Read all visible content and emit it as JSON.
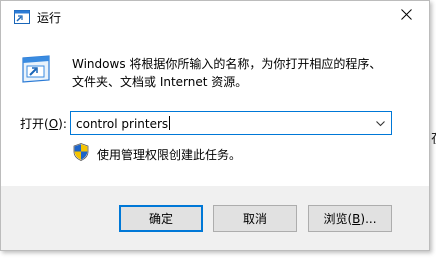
{
  "window": {
    "title": "运行",
    "close_label": "✕"
  },
  "description": {
    "line1": "Windows 将根据你所输入的名称，为你打开相应的程序、",
    "line2": "文件夹、文档或 Internet 资源。"
  },
  "open": {
    "label_prefix": "打开(",
    "mnemonic": "O",
    "label_suffix": "):",
    "value": "control printers"
  },
  "admin_note": "使用管理权限创建此任务。",
  "buttons": {
    "ok": "确定",
    "cancel": "取消",
    "browse_prefix": "浏览(",
    "browse_mnemonic": "B",
    "browse_suffix": ")..."
  },
  "background_text": "在",
  "colors": {
    "accent": "#0078d7",
    "footer": "#f0f0f0",
    "button": "#e1e1e1"
  },
  "icons": [
    "run-app-icon",
    "close-icon",
    "run-app-large-icon",
    "chevron-down-icon",
    "uac-shield-icon"
  ]
}
